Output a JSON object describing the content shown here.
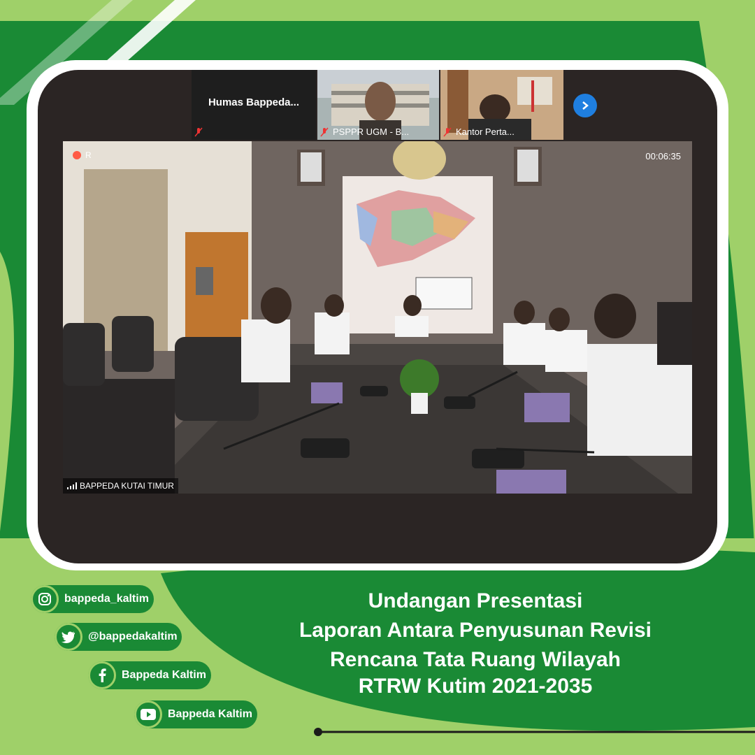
{
  "colors": {
    "light_green": "#9fd069",
    "dark_green": "#1a8a35",
    "frame": "#ffffff"
  },
  "call": {
    "participants": [
      {
        "name": "Humas  Bappeda...",
        "muted": true
      },
      {
        "name": "PSPPR UGM - B...",
        "muted": true
      },
      {
        "name": "Kantor Perta...",
        "muted": true
      }
    ],
    "next_icon": "chevron-right-icon",
    "main_feed": {
      "recording_label": "R",
      "timer": "00:06:35",
      "speaker_name": "BAPPEDA KUTAI TIMUR"
    }
  },
  "socials": [
    {
      "icon": "instagram-icon",
      "handle": "bappeda_kaltim"
    },
    {
      "icon": "twitter-icon",
      "handle": "@bappedakaltim"
    },
    {
      "icon": "facebook-icon",
      "handle": "Bappeda Kaltim"
    },
    {
      "icon": "youtube-icon",
      "handle": "Bappeda Kaltim"
    }
  ],
  "headline": {
    "line1": "Undangan Presentasi",
    "line2": "Laporan Antara Penyusunan Revisi",
    "line3": "Rencana Tata Ruang Wilayah",
    "line4": "RTRW Kutim 2021-2035"
  }
}
